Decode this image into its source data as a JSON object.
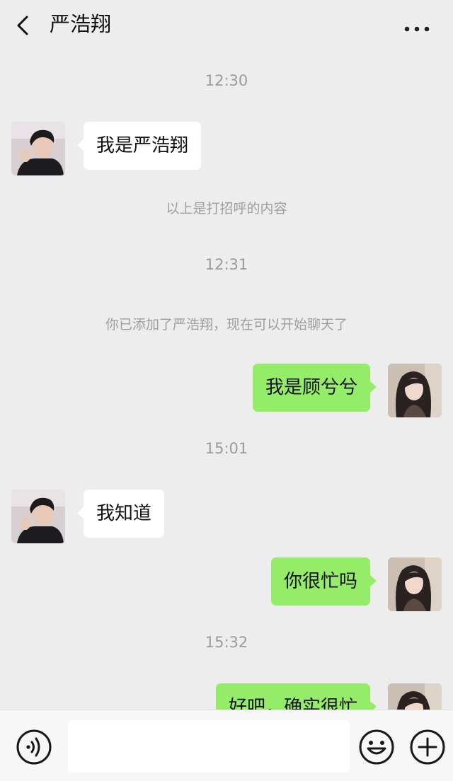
{
  "header": {
    "title": "严浩翔",
    "back_icon": "chevron-left-icon",
    "more_icon": "more-dots-icon"
  },
  "messages": [
    {
      "type": "time",
      "text": "12:30"
    },
    {
      "type": "incoming",
      "text": "我是严浩翔"
    },
    {
      "type": "system",
      "text": "以上是打招呼的内容"
    },
    {
      "type": "time",
      "text": "12:31"
    },
    {
      "type": "system",
      "text": "你已添加了严浩翔，现在可以开始聊天了"
    },
    {
      "type": "outgoing",
      "text": "我是顾兮兮"
    },
    {
      "type": "time",
      "text": "15:01"
    },
    {
      "type": "incoming",
      "text": "我知道"
    },
    {
      "type": "outgoing",
      "text": "你很忙吗"
    },
    {
      "type": "time",
      "text": "15:32"
    },
    {
      "type": "outgoing",
      "text": "好吧，确实很忙"
    }
  ],
  "input_bar": {
    "voice_icon": "voice-icon",
    "text_value": "",
    "emoji_icon": "emoji-icon",
    "plus_icon": "plus-icon"
  },
  "colors": {
    "background": "#ededed",
    "outgoing_bubble": "#95ec69",
    "incoming_bubble": "#ffffff",
    "meta_text": "#9b9b9b"
  }
}
